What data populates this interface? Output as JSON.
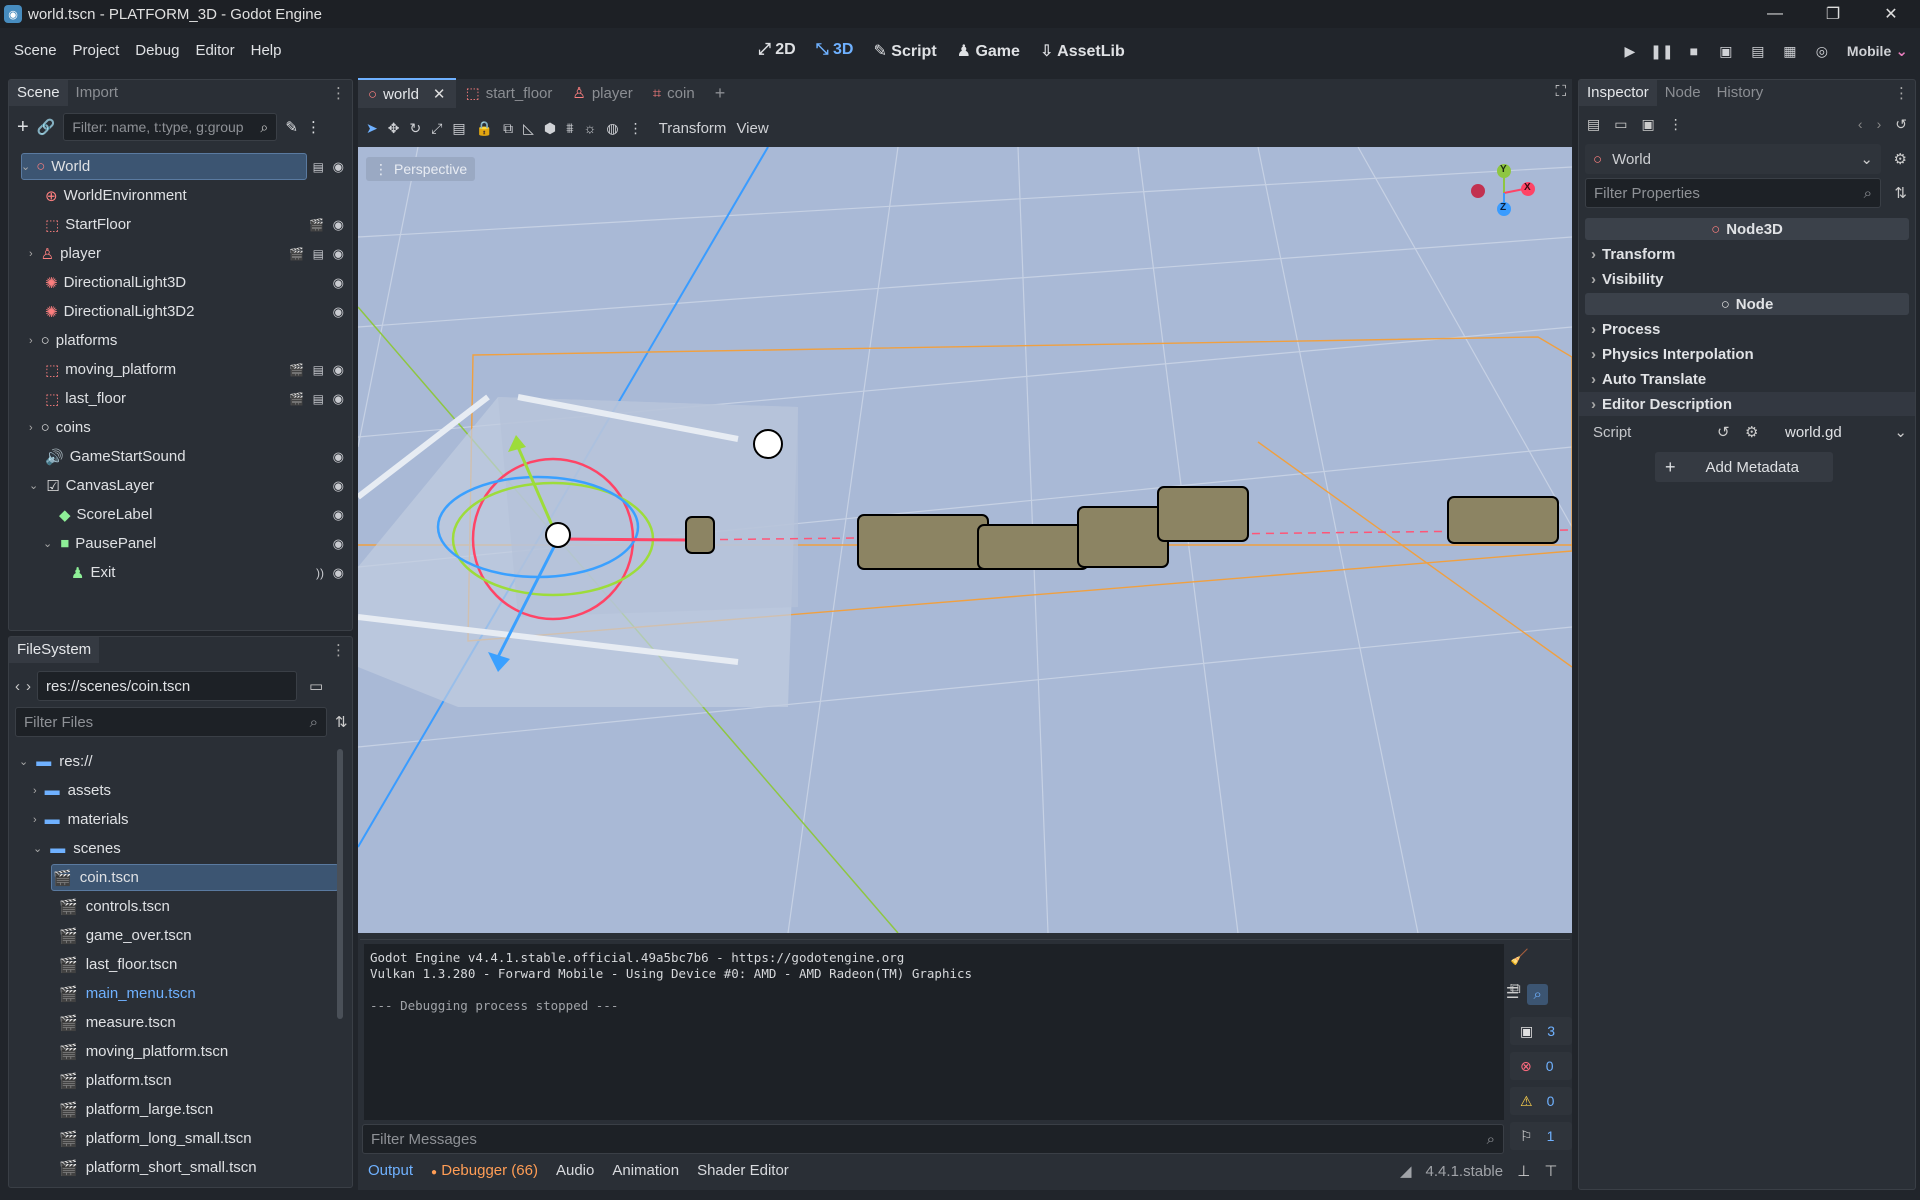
{
  "window": {
    "title": "world.tscn - PLATFORM_3D - Godot Engine"
  },
  "menu": [
    "Scene",
    "Project",
    "Debug",
    "Editor",
    "Help"
  ],
  "modes": [
    {
      "label": "2D",
      "icon": "2d-icon"
    },
    {
      "label": "3D",
      "icon": "3d-icon",
      "active": true
    },
    {
      "label": "Script",
      "icon": "script-icon"
    },
    {
      "label": "Game",
      "icon": "game-icon"
    },
    {
      "label": "AssetLib",
      "icon": "assetlib-icon"
    }
  ],
  "renderer": "Mobile",
  "scene_dock": {
    "tabs": [
      "Scene",
      "Import"
    ],
    "filter_placeholder": "Filter: name, t:type, g:group",
    "nodes": [
      {
        "name": "World",
        "icon": "node3d-icon",
        "selected": true
      },
      {
        "name": "WorldEnvironment",
        "icon": "world-environment-icon"
      },
      {
        "name": "StartFloor",
        "icon": "scene-icon"
      },
      {
        "name": "player",
        "icon": "character-icon"
      },
      {
        "name": "DirectionalLight3D",
        "icon": "light-icon"
      },
      {
        "name": "DirectionalLight3D2",
        "icon": "light-icon"
      },
      {
        "name": "platforms",
        "icon": "node3d-icon"
      },
      {
        "name": "moving_platform",
        "icon": "scene-icon"
      },
      {
        "name": "last_floor",
        "icon": "scene-icon"
      },
      {
        "name": "coins",
        "icon": "node3d-icon"
      },
      {
        "name": "GameStartSound",
        "icon": "audio-icon"
      },
      {
        "name": "CanvasLayer",
        "icon": "canvas-layer-icon"
      },
      {
        "name": "ScoreLabel",
        "icon": "label-icon"
      },
      {
        "name": "PausePanel",
        "icon": "panel-icon"
      },
      {
        "name": "Exit",
        "icon": "button-icon"
      }
    ]
  },
  "filesystem": {
    "tab": "FileSystem",
    "path": "res://scenes/coin.tscn",
    "filter_placeholder": "Filter Files",
    "items": [
      {
        "name": "res://",
        "type": "folder"
      },
      {
        "name": "assets",
        "type": "folder"
      },
      {
        "name": "materials",
        "type": "folder"
      },
      {
        "name": "scenes",
        "type": "folder"
      },
      {
        "name": "coin.tscn",
        "type": "scene",
        "selected": true
      },
      {
        "name": "controls.tscn",
        "type": "scene"
      },
      {
        "name": "game_over.tscn",
        "type": "scene"
      },
      {
        "name": "last_floor.tscn",
        "type": "scene"
      },
      {
        "name": "main_menu.tscn",
        "type": "scene",
        "highlight": true
      },
      {
        "name": "measure.tscn",
        "type": "scene"
      },
      {
        "name": "moving_platform.tscn",
        "type": "scene"
      },
      {
        "name": "platform.tscn",
        "type": "scene"
      },
      {
        "name": "platform_large.tscn",
        "type": "scene"
      },
      {
        "name": "platform_long_small.tscn",
        "type": "scene"
      },
      {
        "name": "platform_short_small.tscn",
        "type": "scene"
      }
    ]
  },
  "doc_tabs": [
    "world",
    "start_floor",
    "player",
    "coin"
  ],
  "viewport": {
    "toolbar_menus": [
      "Transform",
      "View"
    ],
    "perspective_label": "Perspective",
    "gizmo_axes": [
      "Y",
      "X",
      "Z"
    ]
  },
  "inspector": {
    "tabs": [
      "Inspector",
      "Node",
      "History"
    ],
    "object": "World",
    "filter_placeholder": "Filter Properties",
    "class1": "Node3D",
    "sections1": [
      "Transform",
      "Visibility"
    ],
    "class2": "Node",
    "sections2": [
      "Process",
      "Physics Interpolation",
      "Auto Translate",
      "Editor Description"
    ],
    "script_label": "Script",
    "script_value": "world.gd",
    "add_metadata": "Add Metadata"
  },
  "output": {
    "lines": [
      "Godot Engine v4.4.1.stable.official.49a5bc7b6 - https://godotengine.org",
      "Vulkan 1.3.280 - Forward Mobile - Using Device #0: AMD - AMD Radeon(TM) Graphics",
      "",
      "--- Debugging process stopped ---"
    ],
    "filter_placeholder": "Filter Messages",
    "counts": {
      "messages": "3",
      "errors": "0",
      "warnings": "0",
      "editor": "1"
    },
    "bottom_tabs": [
      "Output",
      "Debugger (66)",
      "Audio",
      "Animation",
      "Shader Editor"
    ],
    "version": "4.4.1.stable"
  },
  "colors": {
    "accent": "#6fb1ff",
    "renderer": "#e87dbd",
    "node3d": "#fc7f7f",
    "viewport_bg": "#a9b9d6"
  }
}
